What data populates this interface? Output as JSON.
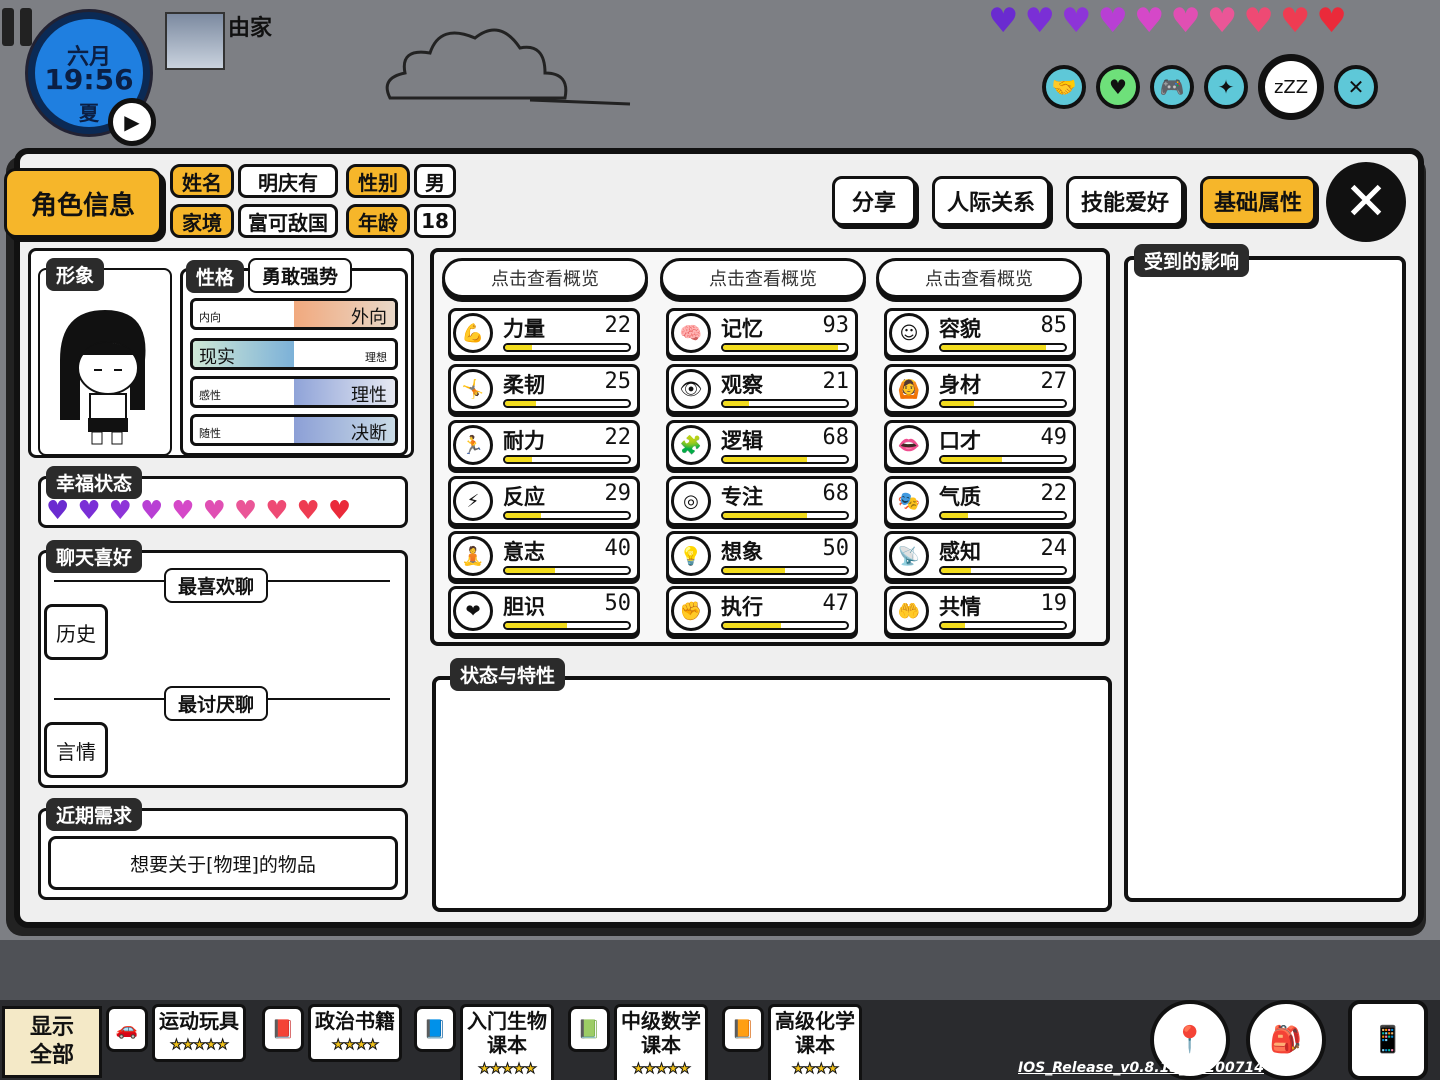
{
  "hud": {
    "month": "六月",
    "time": "19:56",
    "season": "夏",
    "location": "由家",
    "top_hearts": [
      "#6a2bd0",
      "#7a2fd6",
      "#8d34d8",
      "#b83fd4",
      "#d548c8",
      "#e04fb3",
      "#ea5697",
      "#ee4a74",
      "#ee3c52",
      "#ea2a3a"
    ],
    "status_icons": [
      "handshake-icon",
      "heart-icon",
      "gamepad-icon",
      "sparkle-icon",
      "sleep-icon",
      "fork-knife-icon"
    ],
    "sleep_text": "zZZ"
  },
  "panel": {
    "title": "角色信息",
    "name_label": "姓名",
    "name_value": "明庆有",
    "gender_label": "性别",
    "gender_value": "男",
    "family_label": "家境",
    "family_value": "富可敌国",
    "age_label": "年龄",
    "age_value": "18",
    "tabs": {
      "share": "分享",
      "relations": "人际关系",
      "skills": "技能爱好",
      "basic": "基础属性"
    },
    "close": "✕"
  },
  "left": {
    "image_header": "形象",
    "personality_header": "性格",
    "personality_value": "勇敢强势",
    "traits": [
      {
        "left": "内向",
        "right": "外向",
        "value": 0.5
      },
      {
        "left": "现实",
        "right": "理想",
        "value": 0.5
      },
      {
        "left": "感性",
        "right": "理性",
        "value": 0.5
      },
      {
        "left": "随性",
        "right": "决断",
        "value": 0.5
      }
    ],
    "happiness_header": "幸福状态",
    "happy_hearts": [
      "#6a2bd0",
      "#7a2fd6",
      "#8d34d8",
      "#b83fd4",
      "#d548c8",
      "#e04fb3",
      "#ea5697",
      "#ee4a74",
      "#ee3c52",
      "#ea2a3a"
    ],
    "chat_header": "聊天喜好",
    "like_label": "最喜欢聊",
    "like_value": "历史",
    "dislike_label": "最讨厌聊",
    "dislike_value": "言情",
    "need_header": "近期需求",
    "need_value": "想要关于[物理]的物品"
  },
  "stats": {
    "overview_label": "点击查看概览",
    "columns": [
      [
        {
          "icon": "muscle-icon",
          "glyph": "💪",
          "name": "力量",
          "value": 22
        },
        {
          "icon": "stretch-icon",
          "glyph": "🤸",
          "name": "柔韧",
          "value": 25
        },
        {
          "icon": "run-icon",
          "glyph": "🏃",
          "name": "耐力",
          "value": 22
        },
        {
          "icon": "dodge-icon",
          "glyph": "⚡",
          "name": "反应",
          "value": 29
        },
        {
          "icon": "will-icon",
          "glyph": "🧘",
          "name": "意志",
          "value": 40
        },
        {
          "icon": "heart-shield-icon",
          "glyph": "❤",
          "name": "胆识",
          "value": 50
        }
      ],
      [
        {
          "icon": "brain-icon",
          "glyph": "🧠",
          "name": "记忆",
          "value": 93
        },
        {
          "icon": "eye-icon",
          "glyph": "👁",
          "name": "观察",
          "value": 21
        },
        {
          "icon": "puzzle-icon",
          "glyph": "🧩",
          "name": "逻辑",
          "value": 68
        },
        {
          "icon": "target-icon",
          "glyph": "◎",
          "name": "专注",
          "value": 68
        },
        {
          "icon": "bulb-icon",
          "glyph": "💡",
          "name": "想象",
          "value": 50
        },
        {
          "icon": "fist-icon",
          "glyph": "✊",
          "name": "执行",
          "value": 47
        }
      ],
      [
        {
          "icon": "mirror-icon",
          "glyph": "☺",
          "name": "容貌",
          "value": 85
        },
        {
          "icon": "body-icon",
          "glyph": "🙆",
          "name": "身材",
          "value": 27
        },
        {
          "icon": "lips-icon",
          "glyph": "👄",
          "name": "口才",
          "value": 49
        },
        {
          "icon": "mask-icon",
          "glyph": "🎭",
          "name": "气质",
          "value": 22
        },
        {
          "icon": "sense-icon",
          "glyph": "📡",
          "name": "感知",
          "value": 24
        },
        {
          "icon": "empathy-icon",
          "glyph": "🤲",
          "name": "共情",
          "value": 19
        }
      ]
    ],
    "max": 100
  },
  "status_header": "状态与特性",
  "influence_header": "受到的影响",
  "bottom": {
    "show_all": [
      "显示",
      "全部"
    ],
    "items": [
      {
        "icon": "toy-icon",
        "glyph": "🚗",
        "label": "运动玩具",
        "label2": "",
        "stars": "★★★★★"
      },
      {
        "icon": "book-icon",
        "glyph": "📕",
        "label": "政治书籍",
        "label2": "",
        "stars": "★★★★"
      },
      {
        "icon": "book-icon",
        "glyph": "📘",
        "label": "入门生物",
        "label2": "课本",
        "stars": "★★★★★"
      },
      {
        "icon": "book-icon",
        "glyph": "📗",
        "label": "中级数学",
        "label2": "课本",
        "stars": "★★★★★"
      },
      {
        "icon": "book-icon",
        "glyph": "📙",
        "label": "高级化学",
        "label2": "课本",
        "stars": "★★★★"
      }
    ],
    "version": "IOS_Release_v0.8.15_20200714"
  }
}
